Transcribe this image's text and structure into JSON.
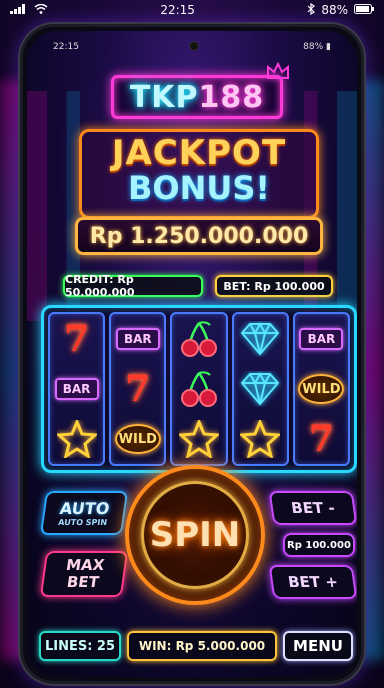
{
  "os_status": {
    "time": "22:15",
    "battery": "88%"
  },
  "phone_status": {
    "time": "22:15",
    "battery": "88%"
  },
  "logo": {
    "part1": "TKP",
    "part2": "188"
  },
  "jackpot": {
    "title": "JACKPOT",
    "subtitle": "BONUS!",
    "amount": "Rp 1.250.000.000"
  },
  "info": {
    "credit": "CREDIT: Rp 50.000.000",
    "bet": "BET: Rp 100.000"
  },
  "reels": [
    [
      "seven",
      "bar",
      "star"
    ],
    [
      "bar",
      "seven",
      "wild"
    ],
    [
      "cherry",
      "cherry",
      "star"
    ],
    [
      "diamond",
      "diamond",
      "star"
    ],
    [
      "bar",
      "wild",
      "seven"
    ]
  ],
  "symbol_labels": {
    "bar": "BAR",
    "wild": "WILD",
    "seven": "7"
  },
  "buttons": {
    "auto": "AUTO",
    "auto_sub": "AUTO SPIN",
    "max_bet_1": "MAX",
    "max_bet_2": "BET",
    "spin": "SPIN",
    "bet_minus": "BET -",
    "bet_value": "Rp 100.000",
    "bet_plus": "BET +"
  },
  "footer": {
    "lines": "LINES: 25",
    "win": "WIN: Rp 5.000.000",
    "menu": "MENU"
  },
  "colors": {
    "cyan": "#28d8ff",
    "pink": "#ff3ad8",
    "orange": "#ff8a1c",
    "green": "#3aff5a",
    "gold": "#ffd23a",
    "purple": "#c84aff"
  },
  "icons": {
    "wifi": "wifi-icon",
    "bluetooth": "bluetooth-icon",
    "battery": "battery-icon",
    "signal": "signal-icon",
    "crown": "crown-icon"
  }
}
